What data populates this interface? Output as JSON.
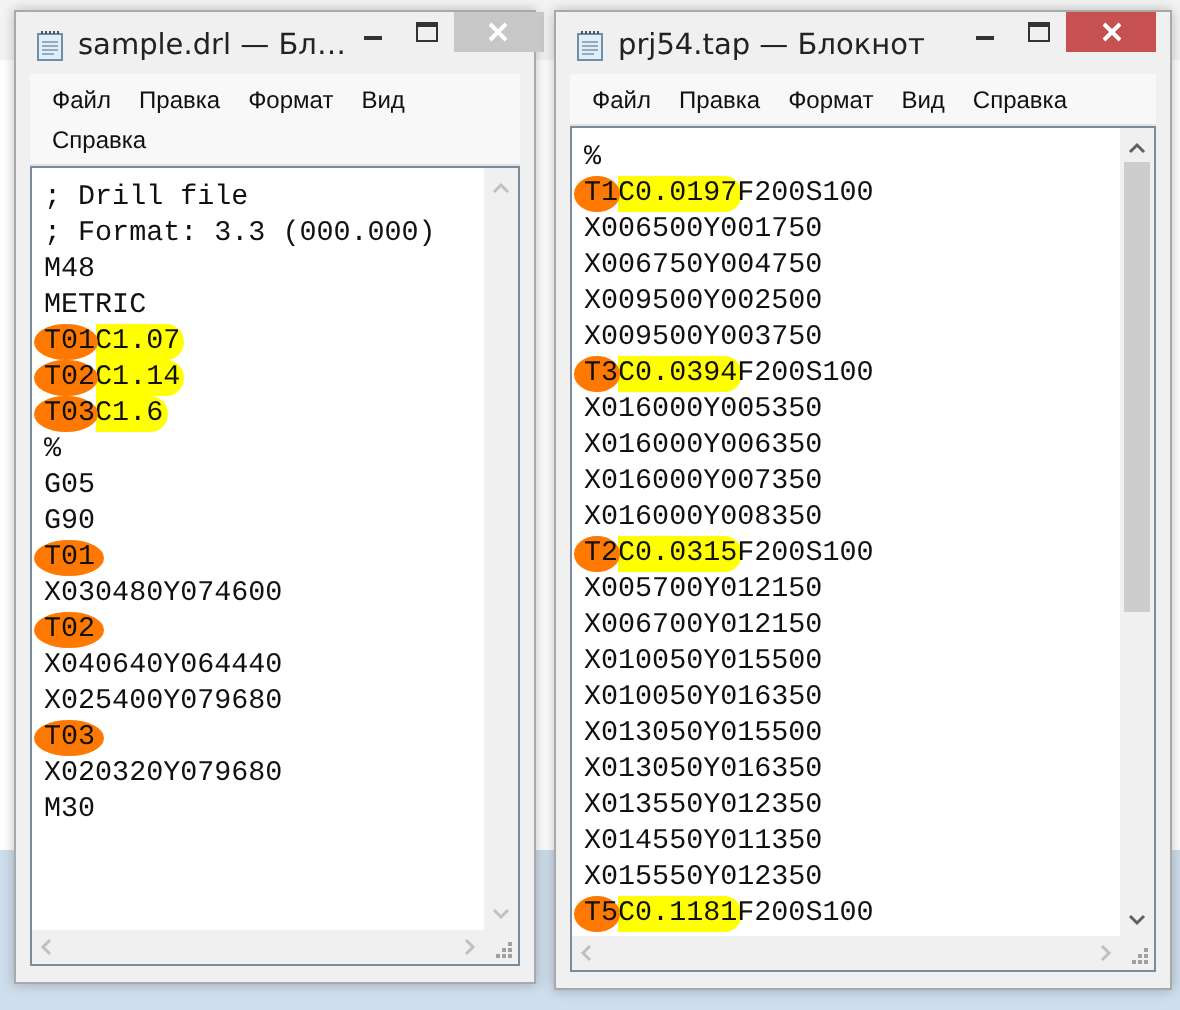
{
  "windows": [
    {
      "title": "sample.drl — Бл…",
      "active": false,
      "scrollable": false,
      "menu_rows": [
        [
          "Файл",
          "Правка",
          "Формат",
          "Вид"
        ],
        [
          "Справка"
        ]
      ],
      "lines": [
        [
          {
            "text": "; Drill file"
          }
        ],
        [
          {
            "text": "; Format: 3.3 (000.000)"
          }
        ],
        [
          {
            "text": "M48"
          }
        ],
        [
          {
            "text": "METRIC"
          }
        ],
        [
          {
            "text": "T01",
            "color": "#ff7800"
          },
          {
            "text": "C1.07",
            "color": "#ffff00"
          }
        ],
        [
          {
            "text": "T02",
            "color": "#ff7800"
          },
          {
            "text": "C1.14",
            "color": "#ffff00"
          }
        ],
        [
          {
            "text": "T03",
            "color": "#ff7800"
          },
          {
            "text": "C1.6",
            "color": "#ffff00"
          }
        ],
        [
          {
            "text": "%"
          }
        ],
        [
          {
            "text": "G05"
          }
        ],
        [
          {
            "text": "G90"
          }
        ],
        [
          {
            "text": "T01",
            "color": "#ff7800"
          }
        ],
        [
          {
            "text": "X030480Y074600"
          }
        ],
        [
          {
            "text": "T02",
            "color": "#ff7800"
          }
        ],
        [
          {
            "text": "X040640Y064440"
          }
        ],
        [
          {
            "text": "X025400Y079680"
          }
        ],
        [
          {
            "text": "T03",
            "color": "#ff7800"
          }
        ],
        [
          {
            "text": "X020320Y079680"
          }
        ],
        [
          {
            "text": "M30"
          }
        ]
      ]
    },
    {
      "title": "prj54.tap — Блокнот",
      "active": true,
      "scrollable": true,
      "menu_rows": [
        [
          "Файл",
          "Правка",
          "Формат",
          "Вид",
          "Справка"
        ]
      ],
      "lines": [
        [
          {
            "text": "%"
          }
        ],
        [
          {
            "text": "T1",
            "color": "#ff7800"
          },
          {
            "text": "C0.0197",
            "color": "#ffff00"
          },
          {
            "text": "F200S100"
          }
        ],
        [
          {
            "text": "X006500Y001750"
          }
        ],
        [
          {
            "text": "X006750Y004750"
          }
        ],
        [
          {
            "text": "X009500Y002500"
          }
        ],
        [
          {
            "text": "X009500Y003750"
          }
        ],
        [
          {
            "text": "T3",
            "color": "#ff7800"
          },
          {
            "text": "C0.0394",
            "color": "#ffff00"
          },
          {
            "text": "F200S100"
          }
        ],
        [
          {
            "text": "X016000Y005350"
          }
        ],
        [
          {
            "text": "X016000Y006350"
          }
        ],
        [
          {
            "text": "X016000Y007350"
          }
        ],
        [
          {
            "text": "X016000Y008350"
          }
        ],
        [
          {
            "text": "T2",
            "color": "#ff7800"
          },
          {
            "text": "C0.0315",
            "color": "#ffff00"
          },
          {
            "text": "F200S100"
          }
        ],
        [
          {
            "text": "X005700Y012150"
          }
        ],
        [
          {
            "text": "X006700Y012150"
          }
        ],
        [
          {
            "text": "X010050Y015500"
          }
        ],
        [
          {
            "text": "X010050Y016350"
          }
        ],
        [
          {
            "text": "X013050Y015500"
          }
        ],
        [
          {
            "text": "X013050Y016350"
          }
        ],
        [
          {
            "text": "X013550Y012350"
          }
        ],
        [
          {
            "text": "X014550Y011350"
          }
        ],
        [
          {
            "text": "X015550Y012350"
          }
        ],
        [
          {
            "text": "T5",
            "color": "#ff7800"
          },
          {
            "text": "C0.1181",
            "color": "#ffff00"
          },
          {
            "text": "F200S100"
          }
        ]
      ]
    }
  ]
}
